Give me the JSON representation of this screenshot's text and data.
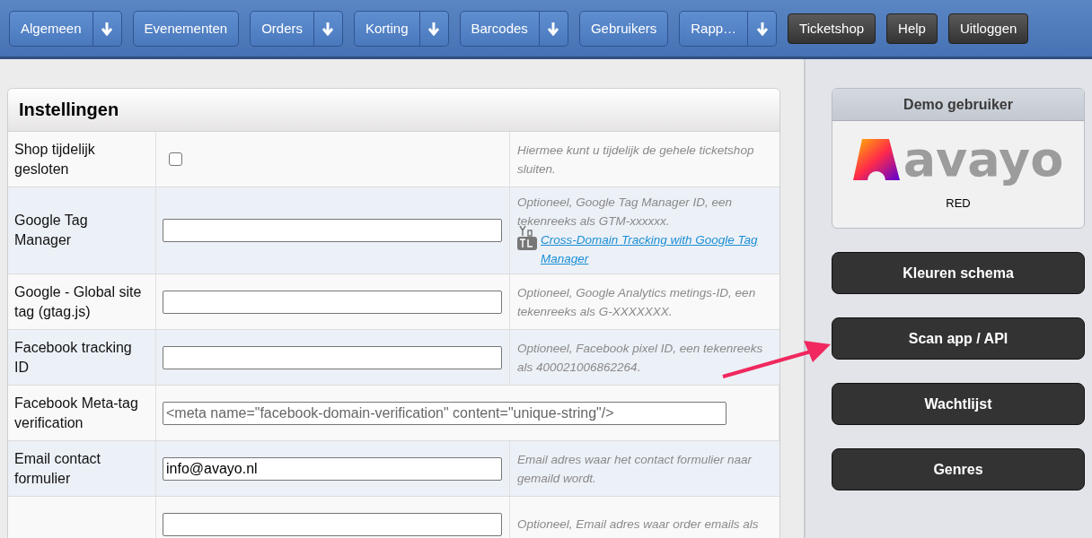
{
  "nav": [
    {
      "label": "Algemeen",
      "kind": "menu",
      "dropdown": true
    },
    {
      "label": "Evenementen",
      "kind": "menu",
      "dropdown": false
    },
    {
      "label": "Orders",
      "kind": "menu",
      "dropdown": true
    },
    {
      "label": "Korting",
      "kind": "menu",
      "dropdown": true
    },
    {
      "label": "Barcodes",
      "kind": "menu",
      "dropdown": true
    },
    {
      "label": "Gebruikers",
      "kind": "menu",
      "dropdown": false
    },
    {
      "label": "Rapp…",
      "kind": "menu",
      "dropdown": true
    },
    {
      "label": "Ticketshop",
      "kind": "action",
      "dropdown": false
    },
    {
      "label": "Help",
      "kind": "action",
      "dropdown": false
    },
    {
      "label": "Uitloggen",
      "kind": "action",
      "dropdown": false
    }
  ],
  "settings": {
    "title": "Instellingen",
    "rows": [
      {
        "kind": "checkbox",
        "label": "Shop tijdelijk gesloten",
        "checked": false,
        "hint": "Hiermee kunt u tijdelijk de gehele ticketshop sluiten."
      },
      {
        "kind": "text",
        "label": "Google Tag Manager",
        "value": "",
        "hint": "Optioneel, Google Tag Manager ID, een tekenreeks als GTM-xxxxxx.",
        "link": "Cross-Domain Tracking with Google Tag Manager"
      },
      {
        "kind": "text",
        "label": "Google - Global site tag (gtag.js)",
        "value": "",
        "hint": "Optioneel, Google Analytics metings-ID, een tekenreeks als G-XXXXXXX."
      },
      {
        "kind": "text",
        "label": "Facebook tracking ID",
        "value": "",
        "hint": "Optioneel, Facebook pixel ID, een tekenreeks als 400021006862264."
      },
      {
        "kind": "wide",
        "label": "Facebook Meta-tag verification",
        "placeholder": "<meta name=\"facebook-domain-verification\" content=\"unique-string\"/>"
      },
      {
        "kind": "text",
        "label": "Email contact formulier",
        "value": "info@avayo.nl",
        "hint": "Email adres waar het contact formulier naar gemaild wordt."
      },
      {
        "kind": "text",
        "value": "",
        "hint": "Optioneel, Email adres waar order emails als"
      }
    ]
  },
  "user_card": {
    "title": "Demo gebruiker",
    "logo_text": "avayo",
    "scheme": "RED"
  },
  "side_buttons": [
    "Kleuren schema",
    "Scan app / API",
    "Wachtlijst",
    "Genres"
  ]
}
